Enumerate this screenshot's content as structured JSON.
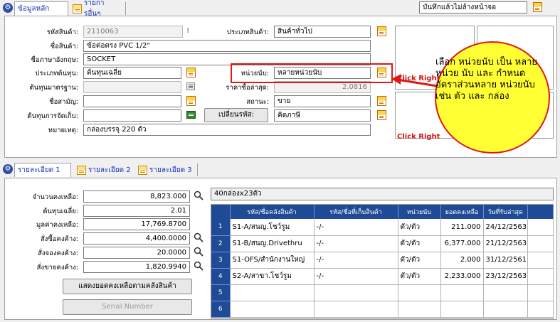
{
  "top_tabs": [
    {
      "label": "ข้อมูลหลัก",
      "active": true
    },
    {
      "label": "รายการอื่นๆ",
      "active": false
    }
  ],
  "top_right_label": "บันทึกแล้วไม่ล้างหน้าจอ",
  "form": {
    "product_code_label": "รหัสสินค้า:",
    "product_code_value": "2110063",
    "product_type_label": "ประเภทสินค้า:",
    "product_type_value": "สินค้าทั่วไป",
    "product_name_label": "ชื่อสินค้า:",
    "product_name_value": "ข้อต่อตรง PVC 1/2\"",
    "english_name_label": "ชื่อภาษาอังกฤษ:",
    "english_name_value": "SOCKET",
    "cost_type_label": "ประเภทต้นทุน:",
    "cost_type_value": "ต้นทุนเฉลี่ย",
    "unit_label": "หน่วยนับ:",
    "unit_value": "หลายหน่วยนับ",
    "standard_cost_label": "ต้นทุนมาตรฐาน:",
    "standard_cost_value": "",
    "last_buy_price_label": "ราคาซื้อล่าสุด:",
    "last_buy_price_value": "2.0816",
    "brand_label": "ชื่อสามัญ:",
    "brand_value": "",
    "status_label": "สถานะ:",
    "status_value": "ขาย",
    "cost_storage_label": "ต้นทุนการจัดเก็บ:",
    "cost_storage_value": "",
    "change_code_button": "เปลี่ยนรหัส:",
    "tax_value": "คิดภาษี",
    "note_label": "หมายเหตุ:",
    "note_value": "กล่องบรรจุ 220 ตัว"
  },
  "image_boxes": [
    {
      "text": "Click Right"
    },
    {
      "text": "Click Right"
    }
  ],
  "callout": {
    "text": "เลือก หน่วยนับ เป็น หลายหน่วย นับ และ กำหนด อัตราส่วนหลาย หน่วยนับ เช่น ตัว และ กล่อง",
    "color": "#ffff33",
    "border_color": "#e01818"
  },
  "sub_tabs": [
    {
      "label": "รายละเอียด 1",
      "active": true
    },
    {
      "label": "รายละเอียด 2",
      "active": false
    },
    {
      "label": "รายละเอียด 3",
      "active": false
    }
  ],
  "summary": {
    "remaining_qty_label": "จำนวนคงเหลือ:",
    "remaining_qty_value": "8,823.000",
    "avg_cost_label": "ต้นทุนเฉลี่ย:",
    "avg_cost_value": "2.01",
    "remaining_value_label": "มูลค่าคงเหลือ:",
    "remaining_value_value": "17,769.8700",
    "po_pending_label": "สั่งซื้อคงค้าง:",
    "po_pending_value": "4,400.0000",
    "reserve_pending_label": "สั่งจองคงค้าง:",
    "reserve_pending_value": "20.0000",
    "so_pending_label": "สั่งขายคงค้าง:",
    "so_pending_value": "1,820.9940",
    "show_stock_button": "แสดงยอดคงเหลือตามคลังสินค้า",
    "serial_button": "Serial Number"
  },
  "packaging_note": "40กล่องx23ตัว",
  "table": {
    "headers": [
      "รหัส/ชื่อคลังสินค้า",
      "รหัส/ชื่อที่เก็บสินค้า",
      "หน่วยนับ",
      "ยอดคงเหลือ",
      "วันที่รับล่าสุด"
    ],
    "rows": [
      {
        "n": "1",
        "warehouse": "S1-A/สนญ.โชว์รูม",
        "location": "-/-",
        "unit": "ตัว/ตัว",
        "balance": "211.000",
        "date": "24/12/2563"
      },
      {
        "n": "2",
        "warehouse": "S1-B/สนญ.Drivethru",
        "location": "-/-",
        "unit": "ตัว/ตัว",
        "balance": "6,377.000",
        "date": "21/12/2563"
      },
      {
        "n": "3",
        "warehouse": "S1-OFS/สำนักงานใหญ่",
        "location": "-/-",
        "unit": "ตัว/ตัว",
        "balance": "2.000",
        "date": "31/12/2561"
      },
      {
        "n": "4",
        "warehouse": "S2-A/สาขา.โชว์รูม",
        "location": "-/-",
        "unit": "ตัว/ตัว",
        "balance": "2,233.000",
        "date": "23/12/2563"
      },
      {
        "n": "5",
        "warehouse": "",
        "location": "",
        "unit": "",
        "balance": "",
        "date": ""
      },
      {
        "n": "6",
        "warehouse": "",
        "location": "",
        "unit": "",
        "balance": "",
        "date": ""
      }
    ]
  }
}
